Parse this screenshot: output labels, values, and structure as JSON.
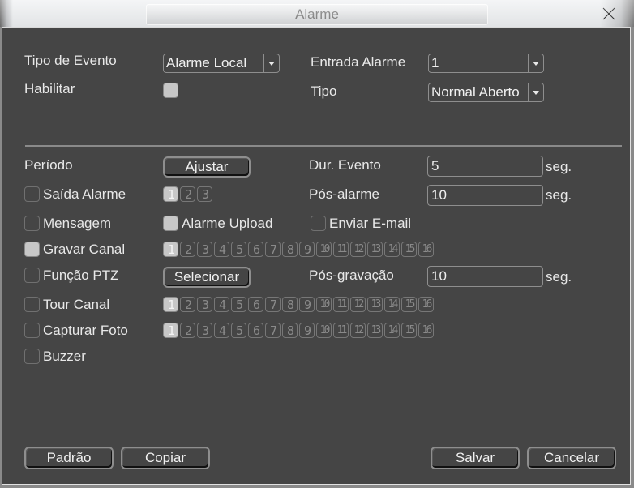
{
  "window": {
    "title": "Alarme"
  },
  "top": {
    "event_type_label": "Tipo de Evento",
    "event_type_value": "Alarme Local",
    "enable_label": "Habilitar",
    "enable_checked": false,
    "alarm_input_label": "Entrada Alarme",
    "alarm_input_value": "1",
    "type_label": "Tipo",
    "type_value": "Normal Aberto"
  },
  "settings": {
    "period_label": "Período",
    "adjust_button": "Ajustar",
    "event_duration_label": "Dur. Evento",
    "event_duration_value": "5",
    "event_duration_unit": "seg.",
    "alarm_output_label": "Saída Alarme",
    "alarm_output_channels": [
      {
        "label": "1",
        "selected": true
      },
      {
        "label": "2",
        "selected": false
      },
      {
        "label": "3",
        "selected": false
      }
    ],
    "post_alarm_label": "Pós-alarme",
    "post_alarm_value": "10",
    "post_alarm_unit": "seg.",
    "message_label": "Mensagem",
    "alarm_upload_label": "Alarme Upload",
    "send_email_label": "Enviar E-mail",
    "record_channel_label": "Gravar Canal",
    "ptz_function_label": "Função PTZ",
    "select_button": "Selecionar",
    "post_record_label": "Pós-gravação",
    "post_record_value": "10",
    "post_record_unit": "seg.",
    "tour_channel_label": "Tour Canal",
    "snapshot_label": "Capturar Foto",
    "buzzer_label": "Buzzer",
    "channels": [
      "1",
      "2",
      "3",
      "4",
      "5",
      "6",
      "7",
      "8",
      "9",
      "10",
      "11",
      "12",
      "13",
      "14",
      "15",
      "16"
    ],
    "selected_channel": "1"
  },
  "footer": {
    "default_button": "Padrão",
    "copy_button": "Copiar",
    "save_button": "Salvar",
    "cancel_button": "Cancelar"
  }
}
